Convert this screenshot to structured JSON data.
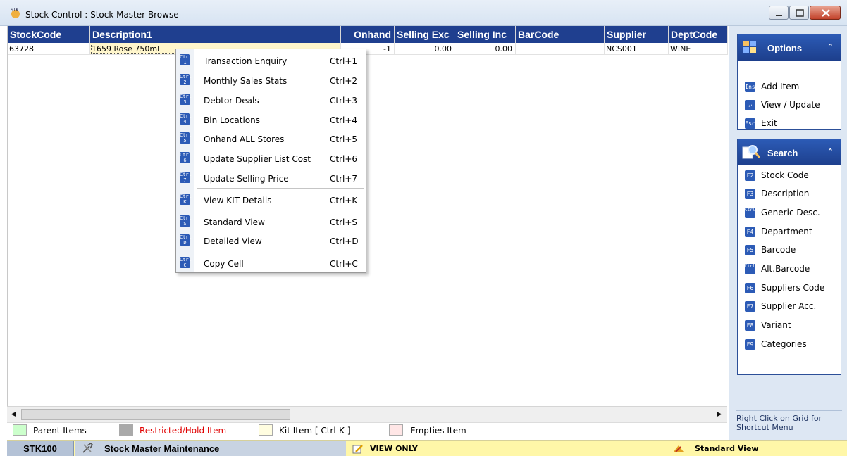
{
  "window": {
    "title": "Stock Control : Stock Master Browse"
  },
  "grid": {
    "columns": [
      "StockCode",
      "Description1",
      "Onhand",
      "Selling Exc",
      "Selling Inc",
      "BarCode",
      "Supplier",
      "DeptCode"
    ],
    "rows": [
      {
        "stock_code": "63728",
        "description": "1659 Rose 750ml",
        "onhand": "-1",
        "selling_exc": "0.00",
        "selling_inc": "0.00",
        "barcode": "",
        "supplier": "NCS001",
        "dept_code": "WINE"
      }
    ]
  },
  "context_menu": {
    "items": [
      {
        "label": "Transaction Enquiry",
        "shortcut": "Ctrl+1",
        "key": "1"
      },
      {
        "label": "Monthly Sales Stats",
        "shortcut": "Ctrl+2",
        "key": "2"
      },
      {
        "label": "Debtor Deals",
        "shortcut": "Ctrl+3",
        "key": "3"
      },
      {
        "label": "Bin Locations",
        "shortcut": "Ctrl+4",
        "key": "4"
      },
      {
        "label": "Onhand ALL Stores",
        "shortcut": "Ctrl+5",
        "key": "5"
      },
      {
        "label": "Update Supplier List Cost",
        "shortcut": "Ctrl+6",
        "key": "6"
      },
      {
        "label": "Update Selling Price",
        "shortcut": "Ctrl+7",
        "key": "7"
      },
      {
        "label": "View KIT Details",
        "shortcut": "Ctrl+K",
        "key": "K"
      },
      {
        "label": "Standard View",
        "shortcut": "Ctrl+S",
        "key": "S"
      },
      {
        "label": "Detailed View",
        "shortcut": "Ctrl+D",
        "key": "D"
      },
      {
        "label": "Copy Cell",
        "shortcut": "Ctrl+C",
        "key": "C"
      }
    ]
  },
  "options_panel": {
    "title": "Options",
    "items": [
      {
        "key": "Ins",
        "label": "Add Item"
      },
      {
        "key": "↵",
        "label": "View / Update"
      },
      {
        "key": "Esc",
        "label": "Exit"
      }
    ]
  },
  "search_panel": {
    "title": "Search",
    "items": [
      {
        "key": "F2",
        "label": "Stock Code"
      },
      {
        "key": "F3",
        "label": "Description"
      },
      {
        "key": "Ctrl F3",
        "label": "Generic Desc."
      },
      {
        "key": "F4",
        "label": "Department"
      },
      {
        "key": "F5",
        "label": "Barcode"
      },
      {
        "key": "Ctrl F5",
        "label": "Alt.Barcode"
      },
      {
        "key": "F6",
        "label": "Suppliers Code"
      },
      {
        "key": "F7",
        "label": "Supplier Acc."
      },
      {
        "key": "F8",
        "label": "Variant"
      },
      {
        "key": "F9",
        "label": "Categories"
      }
    ]
  },
  "hint": "Right Click on Grid for Shortcut Menu",
  "legend": [
    {
      "label": "Parent Items",
      "color": "#ccffcc"
    },
    {
      "label": "Restricted/Hold Item",
      "color": "#a9a9a9",
      "text_color": "#e00000"
    },
    {
      "label": "Kit Item [ Ctrl-K ]",
      "color": "#fffde0"
    },
    {
      "label": "Empties Item",
      "color": "#ffe6e6"
    }
  ],
  "status_bar": {
    "code": "STK100",
    "module": "Stock Master Maintenance",
    "mode": "VIEW ONLY",
    "view": "Standard View"
  }
}
